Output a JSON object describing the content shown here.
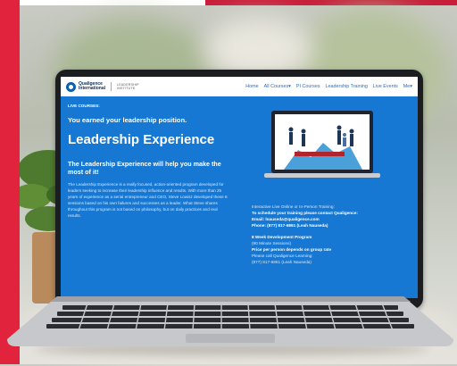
{
  "site": {
    "brand": "Qualigence",
    "brand_sub": "International",
    "institute": "LEADERSHIP",
    "institute_sub": "INSTITUTE"
  },
  "nav": {
    "items": [
      "Home",
      "All Courses",
      "PI Courses",
      "Leadership Training",
      "Live Events",
      "Me"
    ]
  },
  "hero": {
    "kicker": "LIVE COURSES:",
    "subtitle": "You earned your leadership position.",
    "title": "Leadership Experience",
    "tagline": "The Leadership Experience will help you make the most of it!",
    "description": "The Leadership Experience is a really focused, action-oriented program developed for leaders seeking to increase their leadership influence and results. With more than 25 years of experience as a serial entrepreneur and CEO, Steve Lowisz developed these 8 sessions based on his own failures and successes as a leader. What Steve shares throughout this program is not based on philosophy, but on daily practices and real results."
  },
  "info": {
    "line1": "Interactive Live Online or In-Person Training:",
    "line2": "To schedule your training please contact Qualigence:",
    "line3": "Email: lnauseda@qualigence.com",
    "line4": "Phone: (877) 817-6861 (Leah Nauseda)",
    "program": "8 Week Development Program",
    "sessions": "(90 Minute Sessions)",
    "price": "Price per person depends on group rate",
    "call": "Please call Qualigence Learning:",
    "phone": "(877) 817-6861 (Leah Nauseda)"
  },
  "colors": {
    "screen_bg": "#1678d2",
    "accent_red": "#e2233d",
    "nav_link": "#2c6fb8"
  }
}
